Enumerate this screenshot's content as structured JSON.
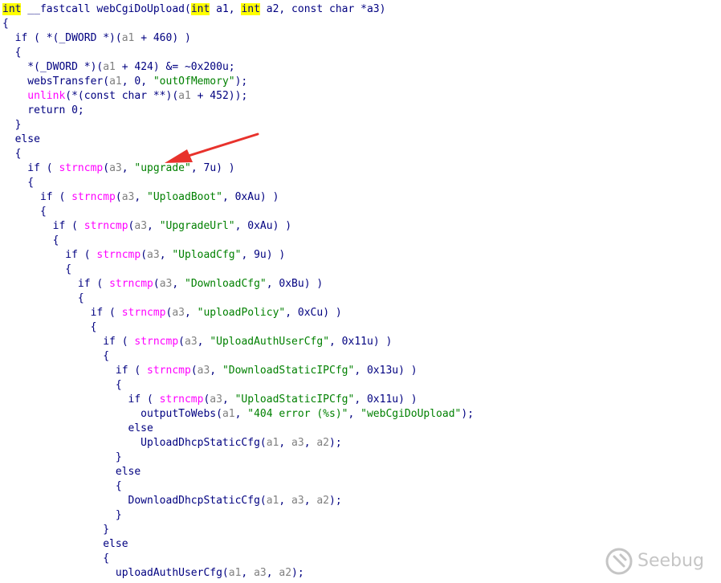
{
  "colors": {
    "plain": "#000080",
    "variable": "#808080",
    "string": "#008000",
    "library_call": "#ff00ff",
    "highlight": "#ffff00",
    "annotation_arrow": "#e8322c"
  },
  "watermark": {
    "text": "Seebug"
  },
  "code_lines": [
    [
      [
        "hl",
        "int"
      ],
      [
        "p",
        " __fastcall webCgiDoUpload("
      ],
      [
        "hl",
        "int"
      ],
      [
        "p",
        " a1, "
      ],
      [
        "hl",
        "int"
      ],
      [
        "p",
        " a2, const char *a3)"
      ]
    ],
    [
      [
        "p",
        "{"
      ]
    ],
    [
      [
        "p",
        "  if ( *(_DWORD *)("
      ],
      [
        "v",
        "a1"
      ],
      [
        "p",
        " + 460) )"
      ]
    ],
    [
      [
        "p",
        "  {"
      ]
    ],
    [
      [
        "p",
        "    *(_DWORD *)("
      ],
      [
        "v",
        "a1"
      ],
      [
        "p",
        " + 424) &= ~0x200u;"
      ]
    ],
    [
      [
        "p",
        "    websTransfer("
      ],
      [
        "v",
        "a1"
      ],
      [
        "p",
        ", 0, "
      ],
      [
        "s",
        "\"outOfMemory\""
      ],
      [
        "p",
        ");"
      ]
    ],
    [
      [
        "l",
        "    unlink"
      ],
      [
        "p",
        "(*(const char **)("
      ],
      [
        "v",
        "a1"
      ],
      [
        "p",
        " + 452));"
      ]
    ],
    [
      [
        "p",
        "    return 0;"
      ]
    ],
    [
      [
        "p",
        "  }"
      ]
    ],
    [
      [
        "p",
        "  else"
      ]
    ],
    [
      [
        "p",
        "  {"
      ]
    ],
    [
      [
        "p",
        "    if ( "
      ],
      [
        "l",
        "strncmp"
      ],
      [
        "p",
        "("
      ],
      [
        "v",
        "a3"
      ],
      [
        "p",
        ", "
      ],
      [
        "s",
        "\"upgrade\""
      ],
      [
        "p",
        ", 7u) )"
      ]
    ],
    [
      [
        "p",
        "    {"
      ]
    ],
    [
      [
        "p",
        "      if ( "
      ],
      [
        "l",
        "strncmp"
      ],
      [
        "p",
        "("
      ],
      [
        "v",
        "a3"
      ],
      [
        "p",
        ", "
      ],
      [
        "s",
        "\"UploadBoot\""
      ],
      [
        "p",
        ", 0xAu) )"
      ]
    ],
    [
      [
        "p",
        "      {"
      ]
    ],
    [
      [
        "p",
        "        if ( "
      ],
      [
        "l",
        "strncmp"
      ],
      [
        "p",
        "("
      ],
      [
        "v",
        "a3"
      ],
      [
        "p",
        ", "
      ],
      [
        "s",
        "\"UpgradeUrl\""
      ],
      [
        "p",
        ", 0xAu) )"
      ]
    ],
    [
      [
        "p",
        "        {"
      ]
    ],
    [
      [
        "p",
        "          if ( "
      ],
      [
        "l",
        "strncmp"
      ],
      [
        "p",
        "("
      ],
      [
        "v",
        "a3"
      ],
      [
        "p",
        ", "
      ],
      [
        "s",
        "\"UploadCfg\""
      ],
      [
        "p",
        ", 9u) )"
      ]
    ],
    [
      [
        "p",
        "          {"
      ]
    ],
    [
      [
        "p",
        "            if ( "
      ],
      [
        "l",
        "strncmp"
      ],
      [
        "p",
        "("
      ],
      [
        "v",
        "a3"
      ],
      [
        "p",
        ", "
      ],
      [
        "s",
        "\"DownloadCfg\""
      ],
      [
        "p",
        ", 0xBu) )"
      ]
    ],
    [
      [
        "p",
        "            {"
      ]
    ],
    [
      [
        "p",
        "              if ( "
      ],
      [
        "l",
        "strncmp"
      ],
      [
        "p",
        "("
      ],
      [
        "v",
        "a3"
      ],
      [
        "p",
        ", "
      ],
      [
        "s",
        "\"uploadPolicy\""
      ],
      [
        "p",
        ", 0xCu) )"
      ]
    ],
    [
      [
        "p",
        "              {"
      ]
    ],
    [
      [
        "p",
        "                if ( "
      ],
      [
        "l",
        "strncmp"
      ],
      [
        "p",
        "("
      ],
      [
        "v",
        "a3"
      ],
      [
        "p",
        ", "
      ],
      [
        "s",
        "\"UploadAuthUserCfg\""
      ],
      [
        "p",
        ", 0x11u) )"
      ]
    ],
    [
      [
        "p",
        "                {"
      ]
    ],
    [
      [
        "p",
        "                  if ( "
      ],
      [
        "l",
        "strncmp"
      ],
      [
        "p",
        "("
      ],
      [
        "v",
        "a3"
      ],
      [
        "p",
        ", "
      ],
      [
        "s",
        "\"DownloadStaticIPCfg\""
      ],
      [
        "p",
        ", 0x13u) )"
      ]
    ],
    [
      [
        "p",
        "                  {"
      ]
    ],
    [
      [
        "p",
        "                    if ( "
      ],
      [
        "l",
        "strncmp"
      ],
      [
        "p",
        "("
      ],
      [
        "v",
        "a3"
      ],
      [
        "p",
        ", "
      ],
      [
        "s",
        "\"UploadStaticIPCfg\""
      ],
      [
        "p",
        ", 0x11u) )"
      ]
    ],
    [
      [
        "p",
        "                      outputToWebs("
      ],
      [
        "v",
        "a1"
      ],
      [
        "p",
        ", "
      ],
      [
        "s",
        "\"404 error (%s)\""
      ],
      [
        "p",
        ", "
      ],
      [
        "s",
        "\"webCgiDoUpload\""
      ],
      [
        "p",
        ");"
      ]
    ],
    [
      [
        "p",
        "                    else"
      ]
    ],
    [
      [
        "p",
        "                      UploadDhcpStaticCfg("
      ],
      [
        "v",
        "a1"
      ],
      [
        "p",
        ", "
      ],
      [
        "v",
        "a3"
      ],
      [
        "p",
        ", "
      ],
      [
        "v",
        "a2"
      ],
      [
        "p",
        ");"
      ]
    ],
    [
      [
        "p",
        "                  }"
      ]
    ],
    [
      [
        "p",
        "                  else"
      ]
    ],
    [
      [
        "p",
        "                  {"
      ]
    ],
    [
      [
        "p",
        "                    DownloadDhcpStaticCfg("
      ],
      [
        "v",
        "a1"
      ],
      [
        "p",
        ", "
      ],
      [
        "v",
        "a3"
      ],
      [
        "p",
        ", "
      ],
      [
        "v",
        "a2"
      ],
      [
        "p",
        ");"
      ]
    ],
    [
      [
        "p",
        "                  }"
      ]
    ],
    [
      [
        "p",
        "                }"
      ]
    ],
    [
      [
        "p",
        "                else"
      ]
    ],
    [
      [
        "p",
        "                {"
      ]
    ],
    [
      [
        "p",
        "                  uploadAuthUserCfg("
      ],
      [
        "v",
        "a1"
      ],
      [
        "p",
        ", "
      ],
      [
        "v",
        "a3"
      ],
      [
        "p",
        ", "
      ],
      [
        "v",
        "a2"
      ],
      [
        "p",
        ");"
      ]
    ]
  ]
}
